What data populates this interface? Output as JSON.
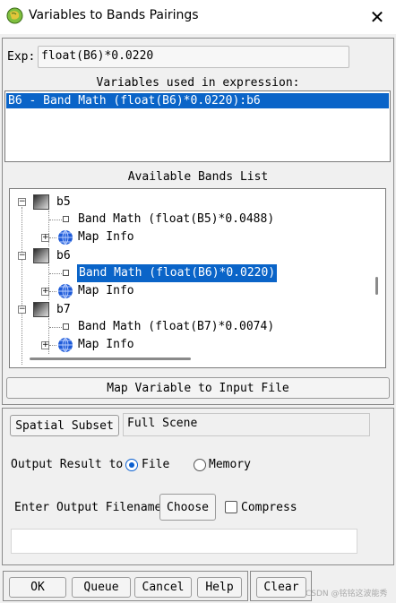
{
  "window": {
    "title": "Variables to Bands Pairings",
    "close_glyph": "✕"
  },
  "expression": {
    "label": "Exp:",
    "value": "float(B6)*0.0220"
  },
  "variables": {
    "header": "Variables used in expression:",
    "items": [
      {
        "text": "B6 - Band Math (float(B6)*0.0220):b6",
        "selected": true
      }
    ]
  },
  "bands": {
    "header": "Available Bands List",
    "tree": [
      {
        "name": "b5",
        "band": "Band Math (float(B5)*0.0488)",
        "map_info": "Map Info",
        "selected": false
      },
      {
        "name": "b6",
        "band": "Band Math (float(B6)*0.0220)",
        "map_info": "Map Info",
        "selected": true
      },
      {
        "name": "b7",
        "band": "Band Math (float(B7)*0.0074)",
        "map_info": "Map Info",
        "selected": false
      }
    ]
  },
  "map_button": "Map Variable to Input File",
  "subset": {
    "button": "Spatial Subset",
    "value": "Full Scene"
  },
  "output": {
    "label": "Output Result to",
    "options": [
      {
        "label": "File",
        "selected": true
      },
      {
        "label": "Memory",
        "selected": false
      }
    ]
  },
  "filename": {
    "label": "Enter Output Filename",
    "choose": "Choose",
    "compress": "Compress",
    "compress_checked": false,
    "value": ""
  },
  "buttons": {
    "ok": "OK",
    "queue": "Queue",
    "cancel": "Cancel",
    "help": "Help",
    "clear": "Clear"
  },
  "watermark": "CSDN @铭铭这波能秀"
}
